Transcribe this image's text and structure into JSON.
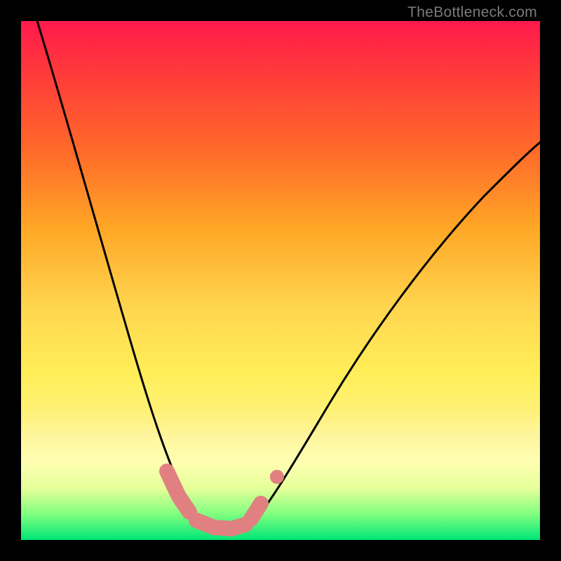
{
  "watermark": "TheBottleneck.com",
  "chart_data": {
    "type": "line",
    "title": "",
    "xlabel": "",
    "ylabel": "",
    "xlim": [
      0,
      100
    ],
    "ylim": [
      0,
      100
    ],
    "series": [
      {
        "name": "bottleneck-curve",
        "x": [
          2,
          5,
          8,
          11,
          14,
          17,
          20,
          23,
          26,
          28,
          30,
          32,
          34,
          36,
          38,
          40,
          42,
          44,
          47,
          50,
          54,
          58,
          62,
          66,
          70,
          74,
          78,
          82,
          86,
          90,
          94,
          98,
          100
        ],
        "values": [
          100,
          92,
          84,
          76,
          68,
          60,
          52,
          44,
          36,
          28,
          22,
          17,
          13,
          9,
          6,
          3,
          2,
          2,
          4,
          8,
          14,
          20,
          26,
          32,
          38,
          43,
          48,
          53,
          57,
          61,
          65,
          68,
          70
        ]
      }
    ],
    "markers": [
      {
        "name": "pink-segment-left",
        "x": [
          27.5,
          30,
          32
        ],
        "values": [
          12,
          6,
          4
        ]
      },
      {
        "name": "pink-segment-bottom",
        "x": [
          33,
          36,
          39,
          42
        ],
        "values": [
          2.5,
          2,
          2,
          2.5
        ]
      },
      {
        "name": "pink-segment-right",
        "x": [
          44,
          46
        ],
        "values": [
          4,
          8
        ]
      },
      {
        "name": "pink-dot-upper-right",
        "x": [
          49
        ],
        "values": [
          14
        ]
      }
    ],
    "background_gradient": {
      "top": "#ff1a4d",
      "mid": "#ffee58",
      "bottom": "#00e676"
    },
    "watermark_text": "TheBottleneck.com"
  }
}
